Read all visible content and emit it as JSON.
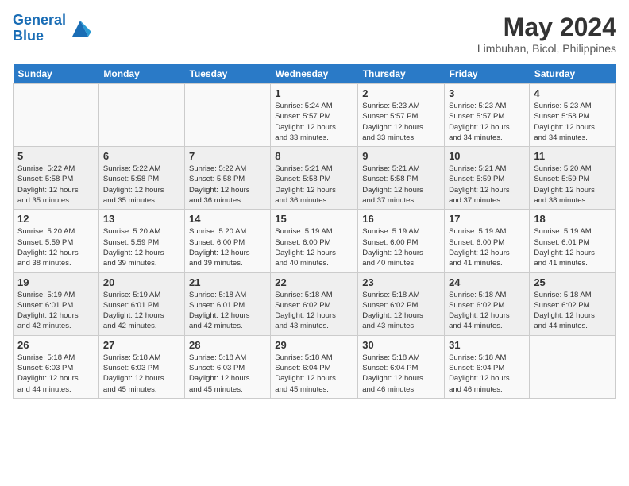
{
  "header": {
    "logo_line1": "General",
    "logo_line2": "Blue",
    "month": "May 2024",
    "location": "Limbuhan, Bicol, Philippines"
  },
  "weekdays": [
    "Sunday",
    "Monday",
    "Tuesday",
    "Wednesday",
    "Thursday",
    "Friday",
    "Saturday"
  ],
  "weeks": [
    [
      {
        "num": "",
        "info": ""
      },
      {
        "num": "",
        "info": ""
      },
      {
        "num": "",
        "info": ""
      },
      {
        "num": "1",
        "info": "Sunrise: 5:24 AM\nSunset: 5:57 PM\nDaylight: 12 hours\nand 33 minutes."
      },
      {
        "num": "2",
        "info": "Sunrise: 5:23 AM\nSunset: 5:57 PM\nDaylight: 12 hours\nand 33 minutes."
      },
      {
        "num": "3",
        "info": "Sunrise: 5:23 AM\nSunset: 5:57 PM\nDaylight: 12 hours\nand 34 minutes."
      },
      {
        "num": "4",
        "info": "Sunrise: 5:23 AM\nSunset: 5:58 PM\nDaylight: 12 hours\nand 34 minutes."
      }
    ],
    [
      {
        "num": "5",
        "info": "Sunrise: 5:22 AM\nSunset: 5:58 PM\nDaylight: 12 hours\nand 35 minutes."
      },
      {
        "num": "6",
        "info": "Sunrise: 5:22 AM\nSunset: 5:58 PM\nDaylight: 12 hours\nand 35 minutes."
      },
      {
        "num": "7",
        "info": "Sunrise: 5:22 AM\nSunset: 5:58 PM\nDaylight: 12 hours\nand 36 minutes."
      },
      {
        "num": "8",
        "info": "Sunrise: 5:21 AM\nSunset: 5:58 PM\nDaylight: 12 hours\nand 36 minutes."
      },
      {
        "num": "9",
        "info": "Sunrise: 5:21 AM\nSunset: 5:58 PM\nDaylight: 12 hours\nand 37 minutes."
      },
      {
        "num": "10",
        "info": "Sunrise: 5:21 AM\nSunset: 5:59 PM\nDaylight: 12 hours\nand 37 minutes."
      },
      {
        "num": "11",
        "info": "Sunrise: 5:20 AM\nSunset: 5:59 PM\nDaylight: 12 hours\nand 38 minutes."
      }
    ],
    [
      {
        "num": "12",
        "info": "Sunrise: 5:20 AM\nSunset: 5:59 PM\nDaylight: 12 hours\nand 38 minutes."
      },
      {
        "num": "13",
        "info": "Sunrise: 5:20 AM\nSunset: 5:59 PM\nDaylight: 12 hours\nand 39 minutes."
      },
      {
        "num": "14",
        "info": "Sunrise: 5:20 AM\nSunset: 6:00 PM\nDaylight: 12 hours\nand 39 minutes."
      },
      {
        "num": "15",
        "info": "Sunrise: 5:19 AM\nSunset: 6:00 PM\nDaylight: 12 hours\nand 40 minutes."
      },
      {
        "num": "16",
        "info": "Sunrise: 5:19 AM\nSunset: 6:00 PM\nDaylight: 12 hours\nand 40 minutes."
      },
      {
        "num": "17",
        "info": "Sunrise: 5:19 AM\nSunset: 6:00 PM\nDaylight: 12 hours\nand 41 minutes."
      },
      {
        "num": "18",
        "info": "Sunrise: 5:19 AM\nSunset: 6:01 PM\nDaylight: 12 hours\nand 41 minutes."
      }
    ],
    [
      {
        "num": "19",
        "info": "Sunrise: 5:19 AM\nSunset: 6:01 PM\nDaylight: 12 hours\nand 42 minutes."
      },
      {
        "num": "20",
        "info": "Sunrise: 5:19 AM\nSunset: 6:01 PM\nDaylight: 12 hours\nand 42 minutes."
      },
      {
        "num": "21",
        "info": "Sunrise: 5:18 AM\nSunset: 6:01 PM\nDaylight: 12 hours\nand 42 minutes."
      },
      {
        "num": "22",
        "info": "Sunrise: 5:18 AM\nSunset: 6:02 PM\nDaylight: 12 hours\nand 43 minutes."
      },
      {
        "num": "23",
        "info": "Sunrise: 5:18 AM\nSunset: 6:02 PM\nDaylight: 12 hours\nand 43 minutes."
      },
      {
        "num": "24",
        "info": "Sunrise: 5:18 AM\nSunset: 6:02 PM\nDaylight: 12 hours\nand 44 minutes."
      },
      {
        "num": "25",
        "info": "Sunrise: 5:18 AM\nSunset: 6:02 PM\nDaylight: 12 hours\nand 44 minutes."
      }
    ],
    [
      {
        "num": "26",
        "info": "Sunrise: 5:18 AM\nSunset: 6:03 PM\nDaylight: 12 hours\nand 44 minutes."
      },
      {
        "num": "27",
        "info": "Sunrise: 5:18 AM\nSunset: 6:03 PM\nDaylight: 12 hours\nand 45 minutes."
      },
      {
        "num": "28",
        "info": "Sunrise: 5:18 AM\nSunset: 6:03 PM\nDaylight: 12 hours\nand 45 minutes."
      },
      {
        "num": "29",
        "info": "Sunrise: 5:18 AM\nSunset: 6:04 PM\nDaylight: 12 hours\nand 45 minutes."
      },
      {
        "num": "30",
        "info": "Sunrise: 5:18 AM\nSunset: 6:04 PM\nDaylight: 12 hours\nand 46 minutes."
      },
      {
        "num": "31",
        "info": "Sunrise: 5:18 AM\nSunset: 6:04 PM\nDaylight: 12 hours\nand 46 minutes."
      },
      {
        "num": "",
        "info": ""
      }
    ]
  ]
}
